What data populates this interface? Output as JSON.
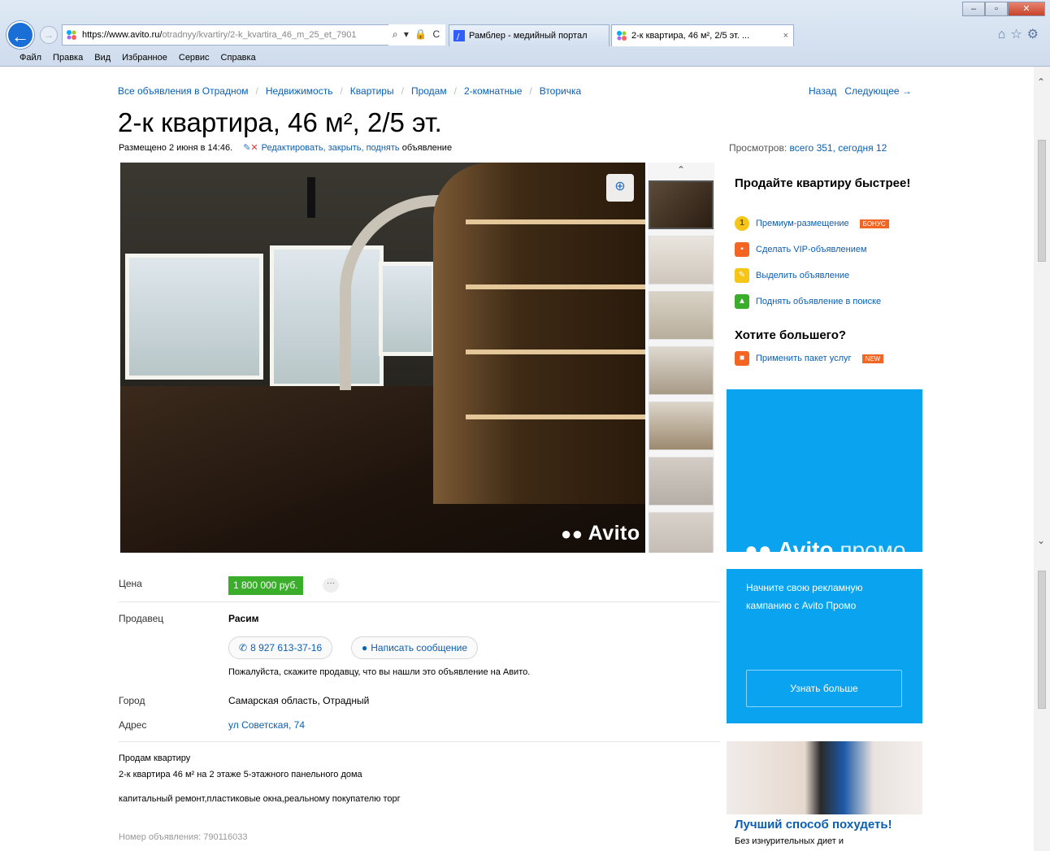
{
  "browser": {
    "address_host": "https://www.avito.ru/",
    "address_path": "otradnyy/kvartiry/2-k_kvartira_46_m_25_et_7901",
    "address_tools": "⌕ ▾ 🔒 C",
    "tabs": [
      {
        "label": "Рамблер - медийный портал"
      },
      {
        "label": "2-к квартира, 46 м², 2/5 эт. ..."
      }
    ],
    "tab_close": "×",
    "menu": [
      "Файл",
      "Правка",
      "Вид",
      "Избранное",
      "Сервис",
      "Справка"
    ]
  },
  "page": {
    "breadcrumbs": [
      "Все объявления в Отрадном",
      "Недвижимость",
      "Квартиры",
      "Продам",
      "2-комнатные",
      "Вторичка"
    ],
    "nav_back": "Назад",
    "nav_next": "Следующее →",
    "title": "2-к квартира, 46 м², 2/5 эт.",
    "posted": "Размещено 2 июня в 14:46.",
    "edit_links": "Редактировать, закрыть, поднять",
    "edit_suffix": "объявление",
    "views_label": "Просмотров:",
    "views_value": "всего 351, сегодня 12",
    "watermark": "Avito"
  },
  "sell_box": {
    "heading": "Продайте квартиру быстрее!",
    "services": [
      {
        "label": "Премиум-размещение",
        "badge": "БОНУС",
        "icon": "coin-icon",
        "color": "#f5c518"
      },
      {
        "label": "Сделать VIP-объявлением",
        "badge": "",
        "icon": "vip-icon",
        "color": "#f26522"
      },
      {
        "label": "Выделить объявление",
        "badge": "",
        "icon": "highlighter-icon",
        "color": "#f5c518"
      },
      {
        "label": "Поднять объявление в поиске",
        "badge": "",
        "icon": "arrow-up-icon",
        "color": "#3aae2b"
      }
    ],
    "more_heading": "Хотите большего?",
    "package": {
      "label": "Применить пакет услуг",
      "badge": "NEW"
    }
  },
  "promo": {
    "brand": "Avito",
    "brand_suffix": "промо",
    "text": "Начните свою рекламную кампанию с Avito Промо",
    "button": "Узнать больше"
  },
  "ad": {
    "headline": "Лучший способ похудеть!",
    "sub": "Без изнурительных диет и"
  },
  "details": {
    "price_label": "Цена",
    "price": "1 800 000 руб.",
    "price_more": "···",
    "seller_label": "Продавец",
    "seller_name": "Расим",
    "phone": "8 927 613-37-16",
    "message": "Написать сообщение",
    "please": "Пожалуйста, скажите продавцу, что вы нашли это объявление на Авито.",
    "city_label": "Город",
    "city": "Самарская область, Отрадный",
    "address_label": "Адрес",
    "address": "ул Советская, 74",
    "desc1": "Продам квартиру",
    "desc2": "2-к квартира 46 м² на 2 этаже 5-этажного панельного дома",
    "desc3": "капитальный ремонт,пластиковые окна,реальному покупателю торг",
    "ad_number_label": "Номер объявления:",
    "ad_number": "790116033"
  },
  "colors": {
    "link": "#0a5fb4",
    "price": "#3aae2b",
    "promo": "#0aa3ef"
  }
}
